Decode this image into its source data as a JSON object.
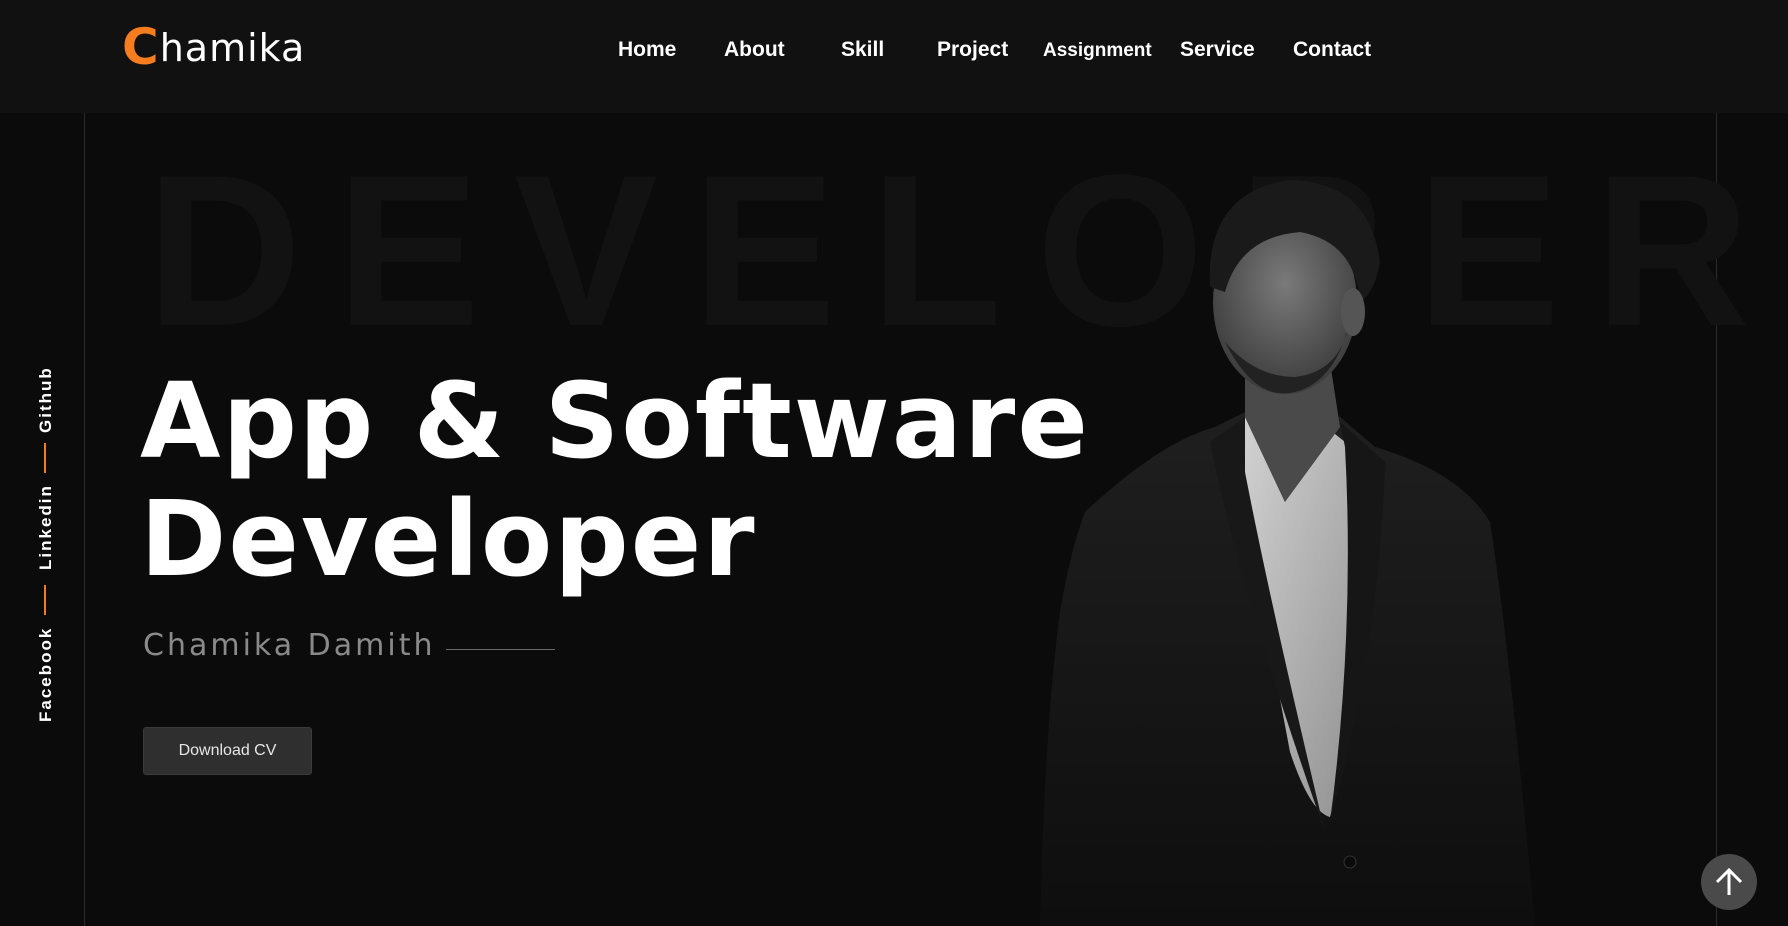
{
  "logo": {
    "initial": "C",
    "rest": "hamika"
  },
  "nav": [
    {
      "label": "Home"
    },
    {
      "label": "About"
    },
    {
      "label": "Skill"
    },
    {
      "label": "Project"
    },
    {
      "label": "Assignment"
    },
    {
      "label": "Service"
    },
    {
      "label": "Contact"
    }
  ],
  "social": {
    "github": "Github",
    "linkedin": "Linkedin",
    "facebook": "Facebook"
  },
  "watermark": "DEVELOPER",
  "hero": {
    "title_line1": "App & Software",
    "title_line2": "Developer",
    "name": "Chamika Damith",
    "cv_button": "Download CV"
  },
  "colors": {
    "accent": "#f57c1f",
    "background": "#0b0b0b",
    "header": "#111111"
  },
  "icons": {
    "scroll_top": "arrow-up-icon"
  }
}
